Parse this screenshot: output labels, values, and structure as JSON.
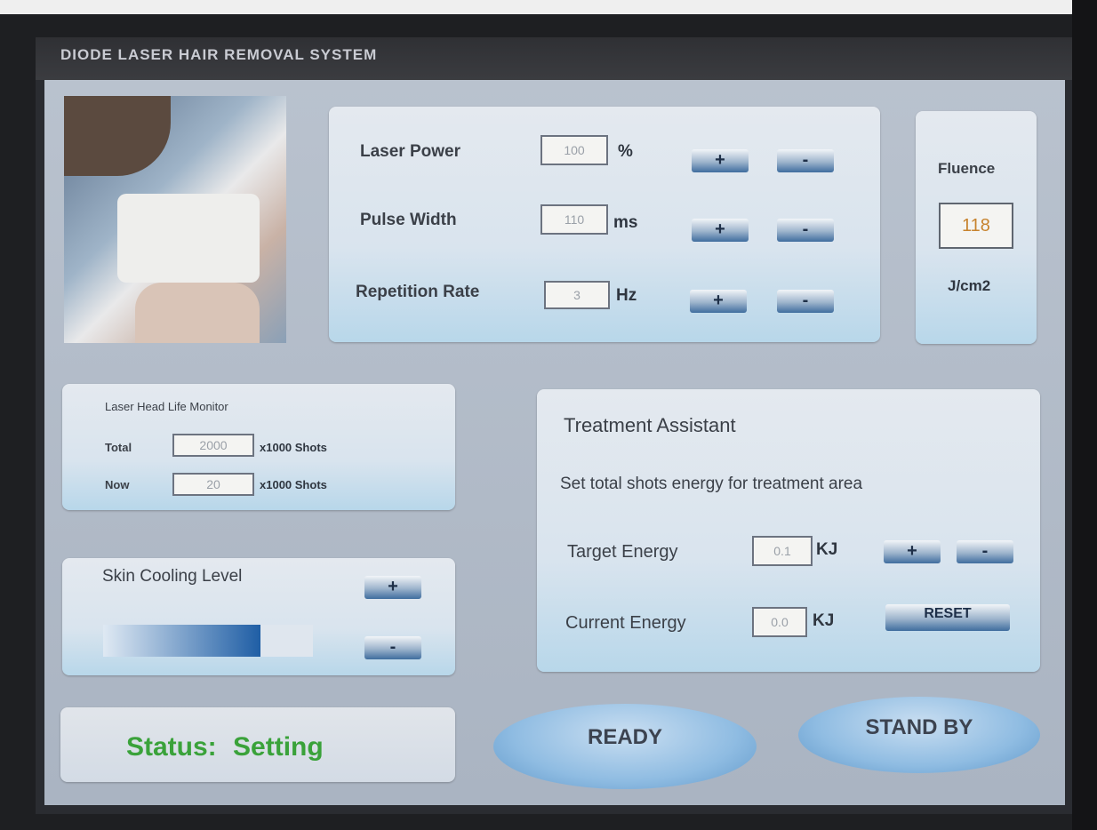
{
  "app": {
    "title": "DIODE LASER HAIR REMOVAL SYSTEM"
  },
  "params": {
    "laser_power": {
      "label": "Laser Power",
      "value": "100",
      "unit": "%"
    },
    "pulse_width": {
      "label": "Pulse Width",
      "value": "110",
      "unit": "ms"
    },
    "repetition_rate": {
      "label": "Repetition Rate",
      "value": "3",
      "unit": "Hz"
    },
    "plus_label": "+",
    "minus_label": "-"
  },
  "fluence": {
    "label": "Fluence",
    "value": "118",
    "unit": "J/cm2"
  },
  "life_monitor": {
    "title": "Laser Head Life Monitor",
    "total": {
      "label": "Total",
      "value": "2000",
      "unit": "x1000 Shots"
    },
    "now": {
      "label": "Now",
      "value": "20",
      "unit": "x1000 Shots"
    }
  },
  "cooling": {
    "title": "Skin Cooling Level",
    "level": 0.75
  },
  "treatment": {
    "title": "Treatment Assistant",
    "subtitle": "Set total shots energy for treatment area",
    "target": {
      "label": "Target Energy",
      "value": "0.1",
      "unit": "KJ"
    },
    "current": {
      "label": "Current Energy",
      "value": "0.0",
      "unit": "KJ"
    },
    "reset_label": "RESET"
  },
  "status": {
    "label": "Status:",
    "value": "Setting"
  },
  "actions": {
    "ready": "READY",
    "standby": "STAND BY"
  },
  "colors": {
    "status_text": "#3aa23a",
    "button_dark": "#3f6d9e",
    "panel_light": "#e4e9ef"
  }
}
